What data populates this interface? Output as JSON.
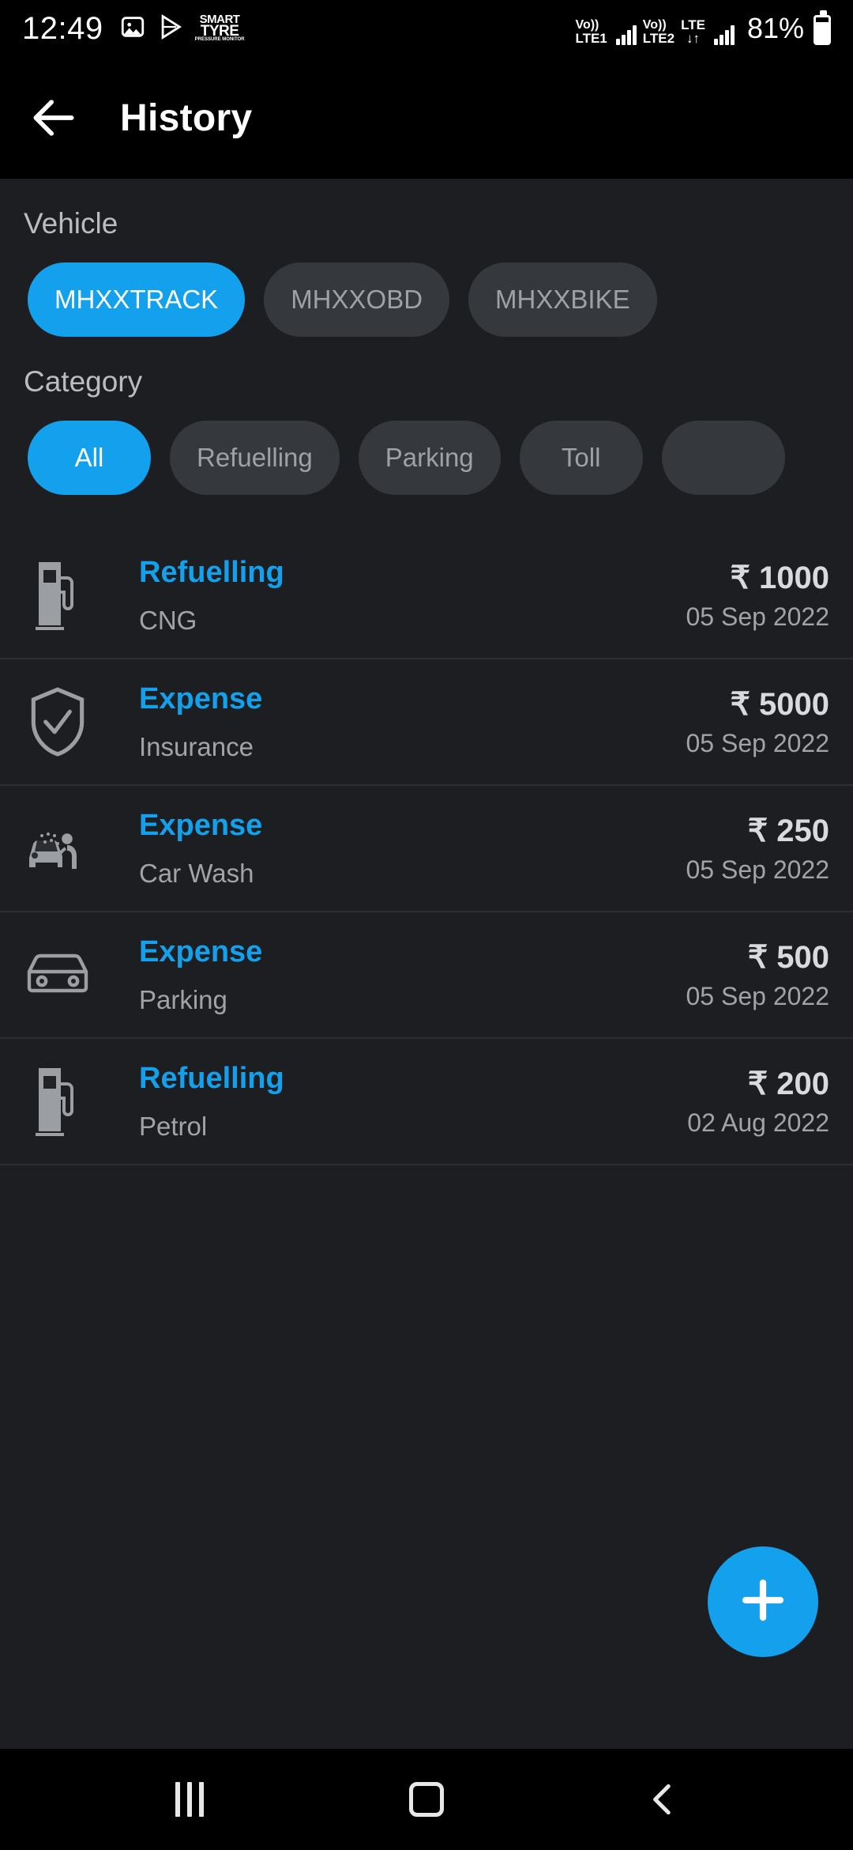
{
  "status_bar": {
    "clock": "12:49",
    "icons": [
      "photo-icon",
      "play-store-icon",
      "smart-tyre-logo"
    ],
    "smart_tyre": {
      "line1": "SMART",
      "line2": "TYRE",
      "line3": "PRESSURE MONITOR"
    },
    "sim1": {
      "volte": "Vo))",
      "network": "LTE1"
    },
    "sim2": {
      "volte": "Vo))",
      "network": "LTE2",
      "data": "LTE",
      "data_arrows": "↓↑"
    },
    "battery": "81%"
  },
  "appbar": {
    "back_icon": "arrow-left-icon",
    "title": "History"
  },
  "filters": {
    "vehicle": {
      "label": "Vehicle",
      "chips": [
        {
          "label": "MHXXTRACK",
          "selected": true
        },
        {
          "label": "MHXXOBD",
          "selected": false
        },
        {
          "label": "MHXXBIKE",
          "selected": false
        }
      ]
    },
    "category": {
      "label": "Category",
      "chips": [
        {
          "label": "All",
          "selected": true
        },
        {
          "label": "Refuelling",
          "selected": false
        },
        {
          "label": "Parking",
          "selected": false
        },
        {
          "label": "Toll",
          "selected": false
        },
        {
          "label": "",
          "selected": false
        }
      ]
    }
  },
  "history": [
    {
      "icon": "fuel-pump-icon",
      "title": "Refuelling",
      "subtitle": "CNG",
      "amount": "₹ 1000",
      "date": "05 Sep 2022"
    },
    {
      "icon": "shield-check-icon",
      "title": "Expense",
      "subtitle": "Insurance",
      "amount": "₹ 5000",
      "date": "05 Sep 2022"
    },
    {
      "icon": "car-wash-icon",
      "title": "Expense",
      "subtitle": "Car Wash",
      "amount": "₹ 250",
      "date": "05 Sep 2022"
    },
    {
      "icon": "car-front-icon",
      "title": "Expense",
      "subtitle": "Parking",
      "amount": "₹ 500",
      "date": "05 Sep 2022"
    },
    {
      "icon": "fuel-pump-icon",
      "title": "Refuelling",
      "subtitle": "Petrol",
      "amount": "₹ 200",
      "date": "02 Aug 2022"
    }
  ],
  "fab": {
    "icon": "plus-icon",
    "label": ""
  },
  "nav_bar": {
    "recents": "recents-icon",
    "home": "home-icon",
    "back": "back-icon"
  },
  "colors": {
    "accent": "#13a0ec",
    "background": "#1c1e21",
    "chip_unselected": "#35383d",
    "bar_black": "#000000",
    "text_primary": "#ffffff",
    "text_secondary": "#a0a4a8"
  }
}
